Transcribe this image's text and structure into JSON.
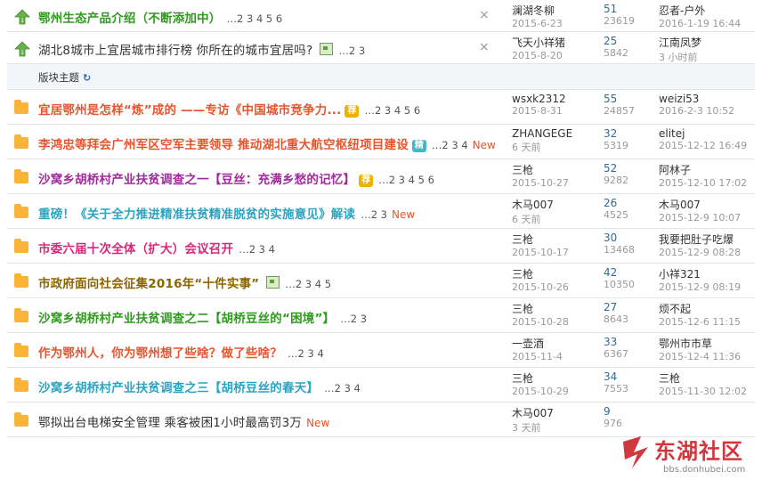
{
  "sticky": [
    {
      "title": "鄂州生态产品介绍（不断添加中）",
      "color": "#2f9a1e",
      "bold": true,
      "pages": "…2 3 4 5 6",
      "close": "×",
      "author": "澜湖冬柳",
      "date": "2015-6-23",
      "replies": "51",
      "views": "23619",
      "last_user": "忍者-户外",
      "last_time": "2016-1-19 16:44"
    },
    {
      "title": "湖北8城市上宜居城市排行榜 你所在的城市宜居吗?",
      "color": "#333",
      "bold": false,
      "has_image": true,
      "pages": "…2 3",
      "close": "×",
      "author": "飞天小祥猪",
      "date": "2015-8-20",
      "replies": "25",
      "views": "5842",
      "last_user": "江南凤梦",
      "last_time": "3 小时前"
    }
  ],
  "separator": {
    "label": "版块主题",
    "refresh": "↻"
  },
  "rows": [
    {
      "title": "宜居鄂州是怎样“炼”成的 ——专访《中国城市竞争力...",
      "color": "#e8542d",
      "bold": true,
      "badge": "荐",
      "badge_color": "#f0b100",
      "pages": "…2 3 4 5 6",
      "author": "wsxk2312",
      "date": "2015-8-31",
      "replies": "55",
      "views": "24857",
      "last_user": "weizi53",
      "last_time": "2016-2-3 10:52"
    },
    {
      "title": "李鸿忠等拜会广州军区空军主要领导 推动湖北重大航空枢纽项目建设",
      "color": "#e8542d",
      "bold": true,
      "badge": "精",
      "badge_color": "#3fb8c9",
      "pages": "…2 3 4",
      "newtag": "New",
      "author": "ZHANGEGE",
      "date": "6 天前",
      "replies": "32",
      "views": "5319",
      "last_user": "elitej",
      "last_time": "2015-12-12 16:49"
    },
    {
      "title": "沙窝乡胡桥村产业扶贫调查之一【豆丝：充满乡愁的记忆】",
      "color": "#a02a9c",
      "bold": true,
      "badge": "荐",
      "badge_color": "#f0b100",
      "pages": "…2 3 4 5 6",
      "author": "三枪",
      "date": "2015-10-27",
      "replies": "52",
      "views": "9282",
      "last_user": "阿林子",
      "last_time": "2015-12-10 17:02"
    },
    {
      "title": "重磅！《关于全力推进精准扶贫精准脱贫的实施意见》解读",
      "color": "#2aa4c2",
      "bold": true,
      "pages": "…2 3",
      "newtag": "New",
      "author": "木马007",
      "date": "6 天前",
      "replies": "26",
      "views": "4525",
      "last_user": "木马007",
      "last_time": "2015-12-9 10:07"
    },
    {
      "title": "市委六届十次全体（扩大）会议召开",
      "color": "#d6297a",
      "bold": true,
      "pages": "…2 3 4",
      "author": "三枪",
      "date": "2015-10-17",
      "replies": "30",
      "views": "13468",
      "last_user": "我要把肚子吃爆",
      "last_time": "2015-12-9 08:28"
    },
    {
      "title": "市政府面向社会征集2016年“十件实事”",
      "color": "#8c6500",
      "bold": true,
      "has_image": true,
      "pages": "…2 3 4 5",
      "author": "三枪",
      "date": "2015-10-26",
      "replies": "42",
      "views": "10350",
      "last_user": "小祥321",
      "last_time": "2015-12-9 08:19"
    },
    {
      "title": "沙窝乡胡桥村产业扶贫调查之二【胡桥豆丝的“困境”】",
      "color": "#2f9a1e",
      "bold": true,
      "pages": "…2 3",
      "author": "三枪",
      "date": "2015-10-28",
      "replies": "27",
      "views": "8643",
      "last_user": "烦不起",
      "last_time": "2015-12-6 11:15"
    },
    {
      "title": "作为鄂州人，你为鄂州想了些啥？做了些啥？",
      "color": "#e8542d",
      "bold": true,
      "pages": "…2 3 4",
      "author": "一壶酒",
      "date": "2015-11-4",
      "replies": "33",
      "views": "6367",
      "last_user": "鄂州市市草",
      "last_time": "2015-12-4 11:36"
    },
    {
      "title": "沙窝乡胡桥村产业扶贫调查之三【胡桥豆丝的春天】",
      "color": "#2aa4c2",
      "bold": true,
      "pages": "…2 3 4",
      "author": "三枪",
      "date": "2015-10-29",
      "replies": "34",
      "views": "7553",
      "last_user": "三枪",
      "last_time": "2015-11-30 12:02"
    },
    {
      "title": "鄂拟出台电梯安全管理 乘客被困1小时最高罚3万",
      "color": "#333",
      "bold": false,
      "newtag": "New",
      "author": "木马007",
      "date": "3 天前",
      "replies": "9",
      "views": "976",
      "last_user": "",
      "last_time": ""
    }
  ],
  "watermark": {
    "name": "东湖社区",
    "url": "bbs.donhubei.com"
  }
}
